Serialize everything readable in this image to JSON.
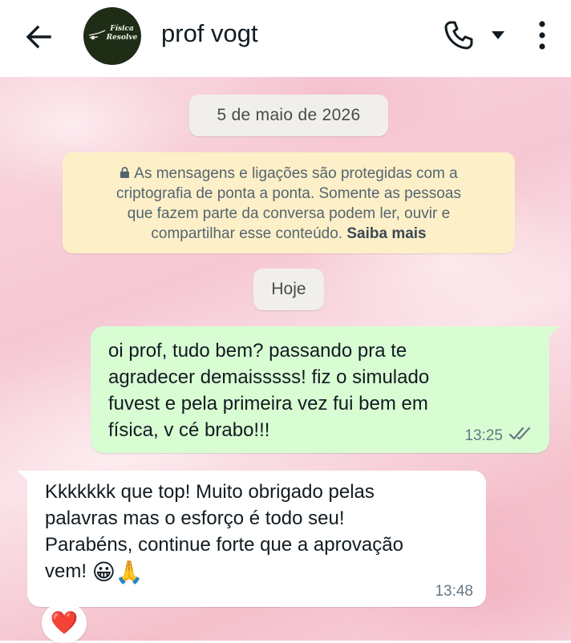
{
  "header": {
    "contact_name": "prof vogt",
    "avatar_text_line1": "Física",
    "avatar_text_line2": "Resolve"
  },
  "chat": {
    "date_separator": "5 de maio de 2026",
    "encryption_notice": {
      "lines": [
        "As mensagens e ligações são protegidas com a",
        "criptografia de ponta a ponta. Somente as pessoas",
        "que fazem parte da conversa podem ler, ouvir e",
        "compartilhar esse conteúdo."
      ],
      "learn_more": "Saiba mais"
    },
    "today_separator": "Hoje",
    "messages": [
      {
        "direction": "outgoing",
        "lines": [
          "oi prof, tudo bem? passando pra te",
          "agradecer demaisssss! fiz o simulado",
          "fuvest e pela primeira vez fui bem em",
          "física, v cé brabo!!!"
        ],
        "time": "13:25",
        "status": "read"
      },
      {
        "direction": "incoming",
        "lines": [
          "Kkkkkkk que top! Muito obrigado pelas",
          "palavras mas o esforço é todo seu!",
          "Parabéns, continue forte que a aprovação",
          "vem!"
        ],
        "emojis": [
          "😀",
          "🙏"
        ],
        "time": "13:48",
        "reaction": "❤️"
      }
    ]
  },
  "colors": {
    "outgoing_bubble": "#d9fdd3",
    "incoming_bubble": "#ffffff",
    "notice_bg": "#fdf0c9",
    "read_ticks": "#667781"
  },
  "icons": {
    "back": "arrow-left-icon",
    "call": "phone-icon",
    "call_options": "caret-down-icon",
    "menu": "more-vertical-icon",
    "lock": "lock-icon",
    "ticks": "double-check-icon"
  }
}
